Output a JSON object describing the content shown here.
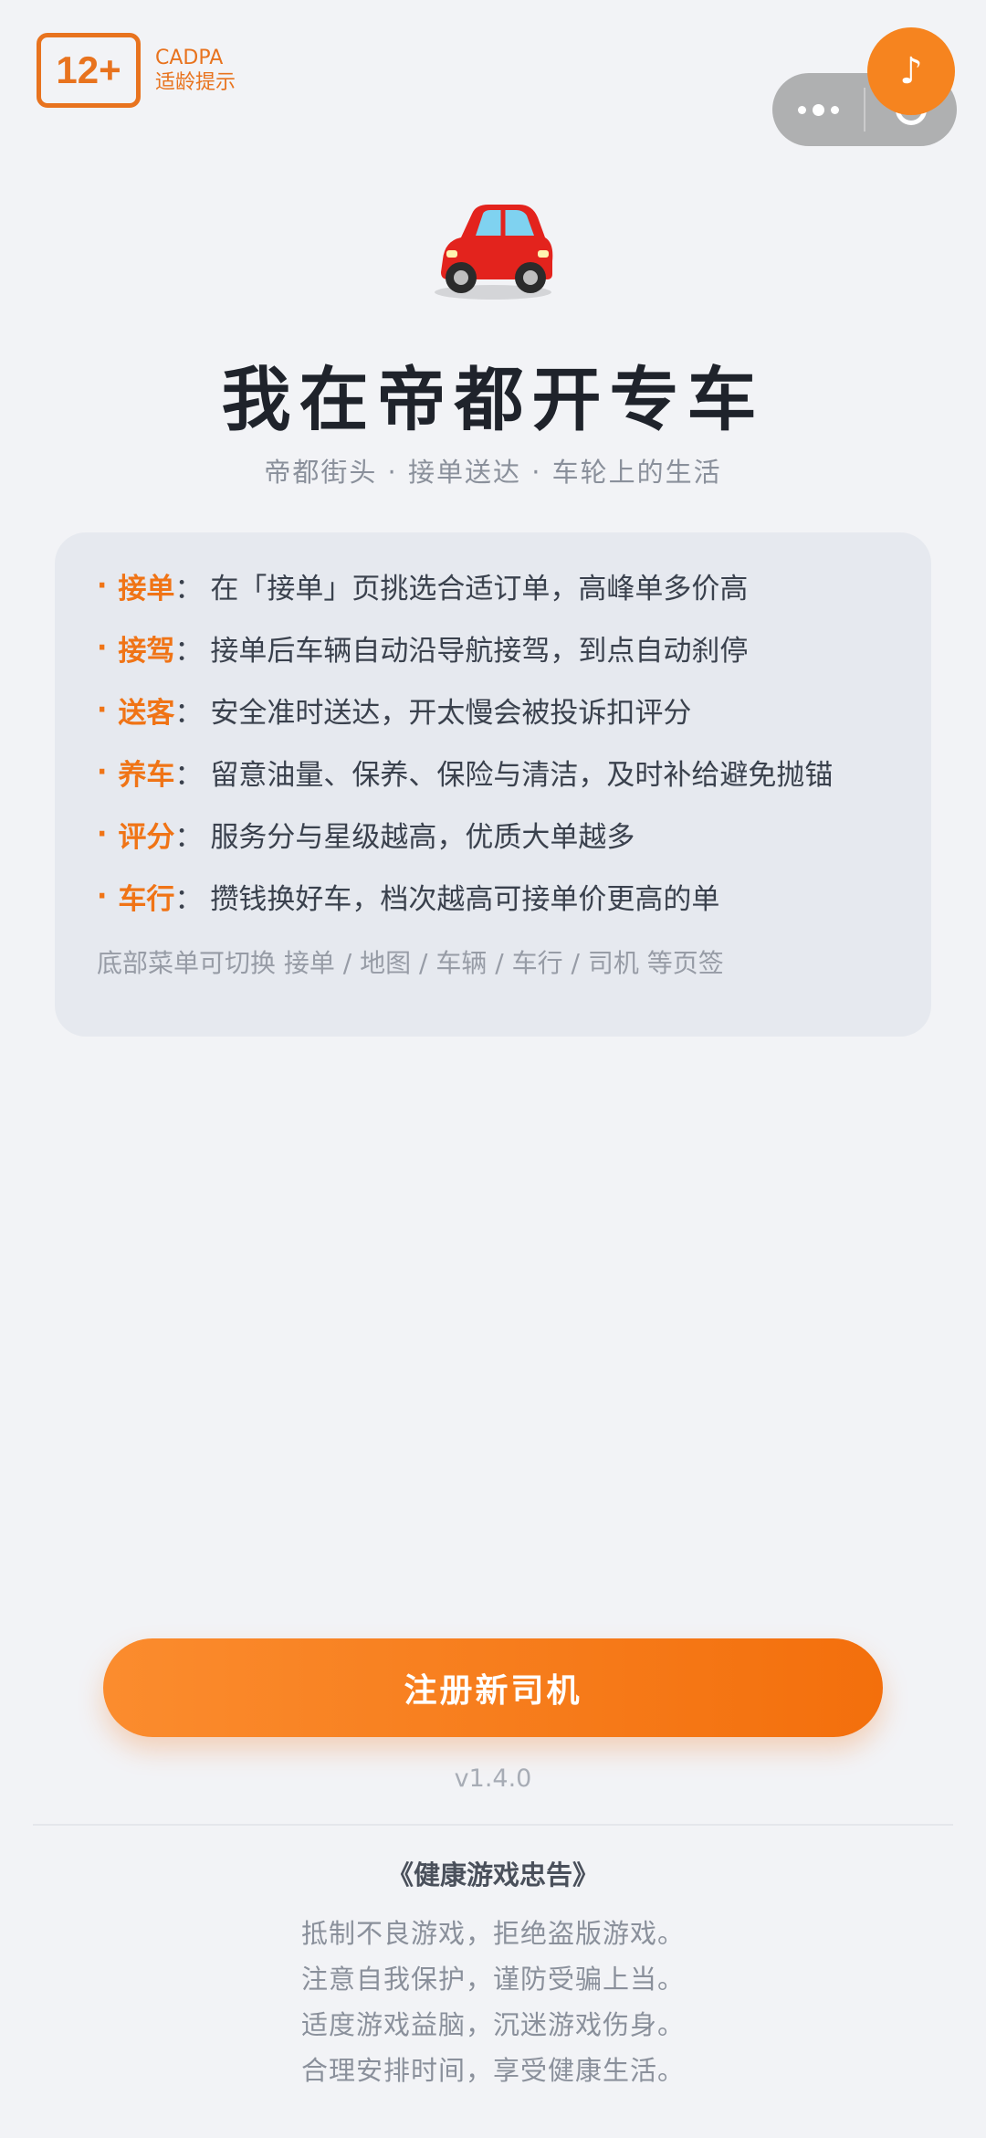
{
  "age_rating": {
    "badge": "12+",
    "org": "CADPA",
    "note": "适龄提示"
  },
  "capsule": {
    "more_icon": "more-dots-icon",
    "close_icon": "target-circle-icon"
  },
  "music": {
    "icon": "♪"
  },
  "hero": {
    "emoji": "🚗",
    "title": "我在帝都开专车",
    "subtitle": "帝都街头 · 接单送达 · 车轮上的生活"
  },
  "rules": [
    {
      "bullet": "·",
      "term": "接单",
      "colon": "：",
      "desc": "在「接单」页挑选合适订单，高峰单多价高"
    },
    {
      "bullet": "·",
      "term": "接驾",
      "colon": "：",
      "desc": "接单后车辆自动沿导航接驾，到点自动刹停"
    },
    {
      "bullet": "·",
      "term": "送客",
      "colon": "：",
      "desc": "安全准时送达，开太慢会被投诉扣评分"
    },
    {
      "bullet": "·",
      "term": "养车",
      "colon": "：",
      "desc": "留意油量、保养、保险与清洁，及时补给避免抛锚"
    },
    {
      "bullet": "·",
      "term": "评分",
      "colon": "：",
      "desc": "服务分与星级越高，优质大单越多"
    },
    {
      "bullet": "·",
      "term": "车行",
      "colon": "：",
      "desc": "攒钱换好车，档次越高可接单价更高的单"
    }
  ],
  "hint": "底部菜单可切换 接单 / 地图 / 车辆 / 车行 / 司机 等页签",
  "register_button": "注册新司机",
  "version": "v1.4.0",
  "health_advice": {
    "title": "《健康游戏忠告》",
    "lines": [
      "抵制不良游戏，拒绝盗版游戏。",
      "注意自我保护，谨防受骗上当。",
      "适度游戏益脑，沉迷游戏伤身。",
      "合理安排时间，享受健康生活。"
    ]
  },
  "colors": {
    "accent": "#f07416",
    "background": "#f2f3f6",
    "card": "#e6e9ef"
  }
}
